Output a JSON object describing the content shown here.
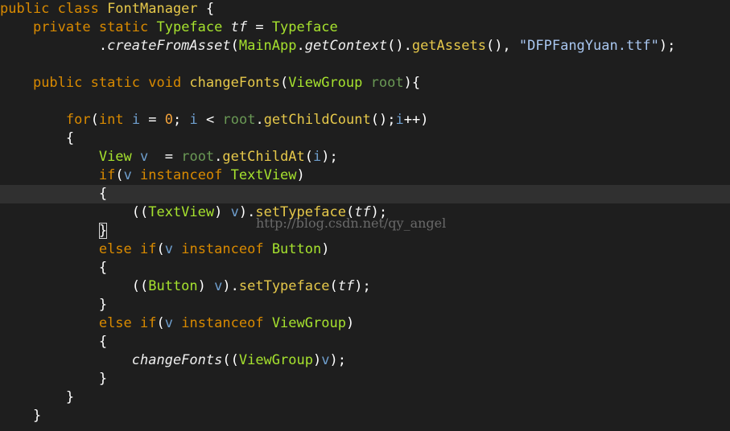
{
  "editor": {
    "lines": [
      [
        [
          "kw",
          "public class "
        ],
        [
          "fn",
          "FontManager"
        ],
        [
          "pu",
          " {"
        ]
      ],
      [
        [
          "pu",
          "    "
        ],
        [
          "kw",
          "private static "
        ],
        [
          "ty",
          "Typeface "
        ],
        [
          "it",
          "tf"
        ],
        [
          "op",
          " = "
        ],
        [
          "ty",
          "Typeface"
        ]
      ],
      [
        [
          "pu",
          "            ."
        ],
        [
          "it",
          "createFromAsset"
        ],
        [
          "pu",
          "("
        ],
        [
          "ty",
          "MainApp"
        ],
        [
          "pu",
          "."
        ],
        [
          "it",
          "getContext"
        ],
        [
          "pu",
          "()."
        ],
        [
          "fn",
          "getAssets"
        ],
        [
          "pu",
          "(), "
        ],
        [
          "str",
          "\"DFPFangYuan.ttf\""
        ],
        [
          "pu",
          ");"
        ]
      ],
      [],
      [
        [
          "pu",
          "    "
        ],
        [
          "kw",
          "public static void "
        ],
        [
          "fn",
          "changeFonts"
        ],
        [
          "pu",
          "("
        ],
        [
          "ty",
          "ViewGroup "
        ],
        [
          "fld",
          "root"
        ],
        [
          "pu",
          "){"
        ]
      ],
      [],
      [
        [
          "pu",
          "        "
        ],
        [
          "kw",
          "for"
        ],
        [
          "pu",
          "("
        ],
        [
          "kw",
          "int "
        ],
        [
          "var",
          "i"
        ],
        [
          "op",
          " = "
        ],
        [
          "num",
          "0"
        ],
        [
          "pu",
          "; "
        ],
        [
          "var",
          "i"
        ],
        [
          "op",
          " < "
        ],
        [
          "fld",
          "root"
        ],
        [
          "pu",
          "."
        ],
        [
          "fn",
          "getChildCount"
        ],
        [
          "pu",
          "();"
        ],
        [
          "var",
          "i"
        ],
        [
          "op",
          "++"
        ],
        [
          "pu",
          ")"
        ]
      ],
      [
        [
          "pu",
          "        {"
        ]
      ],
      [
        [
          "pu",
          "            "
        ],
        [
          "ty",
          "View "
        ],
        [
          "var",
          "v"
        ],
        [
          "op",
          "  = "
        ],
        [
          "fld",
          "root"
        ],
        [
          "pu",
          "."
        ],
        [
          "fn",
          "getChildAt"
        ],
        [
          "pu",
          "("
        ],
        [
          "var",
          "i"
        ],
        [
          "pu",
          ");"
        ]
      ],
      [
        [
          "pu",
          "            "
        ],
        [
          "kw",
          "if"
        ],
        [
          "pu",
          "("
        ],
        [
          "var",
          "v"
        ],
        [
          "kw",
          " instanceof "
        ],
        [
          "ty",
          "TextView"
        ],
        [
          "pu",
          ")"
        ]
      ],
      [
        [
          "pu",
          "            {"
        ]
      ],
      [
        [
          "pu",
          "                (("
        ],
        [
          "ty",
          "TextView"
        ],
        [
          "pu",
          ") "
        ],
        [
          "var",
          "v"
        ],
        [
          "pu",
          ")."
        ],
        [
          "fn",
          "setTypeface"
        ],
        [
          "pu",
          "("
        ],
        [
          "it",
          "tf"
        ],
        [
          "pu",
          ");"
        ]
      ],
      [
        [
          "pu",
          "            "
        ],
        [
          "caret",
          "}"
        ]
      ],
      [
        [
          "pu",
          "            "
        ],
        [
          "kw",
          "else if"
        ],
        [
          "pu",
          "("
        ],
        [
          "var",
          "v"
        ],
        [
          "kw",
          " instanceof "
        ],
        [
          "ty",
          "Button"
        ],
        [
          "pu",
          ")"
        ]
      ],
      [
        [
          "pu",
          "            {"
        ]
      ],
      [
        [
          "pu",
          "                (("
        ],
        [
          "ty",
          "Button"
        ],
        [
          "pu",
          ") "
        ],
        [
          "var",
          "v"
        ],
        [
          "pu",
          ")."
        ],
        [
          "fn",
          "setTypeface"
        ],
        [
          "pu",
          "("
        ],
        [
          "it",
          "tf"
        ],
        [
          "pu",
          ");"
        ]
      ],
      [
        [
          "pu",
          "            }"
        ]
      ],
      [
        [
          "pu",
          "            "
        ],
        [
          "kw",
          "else if"
        ],
        [
          "pu",
          "("
        ],
        [
          "var",
          "v"
        ],
        [
          "kw",
          " instanceof "
        ],
        [
          "ty",
          "ViewGroup"
        ],
        [
          "pu",
          ")"
        ]
      ],
      [
        [
          "pu",
          "            {"
        ]
      ],
      [
        [
          "pu",
          "                "
        ],
        [
          "it",
          "changeFonts"
        ],
        [
          "pu",
          "(("
        ],
        [
          "ty",
          "ViewGroup"
        ],
        [
          "pu",
          ")"
        ],
        [
          "var",
          "v"
        ],
        [
          "pu",
          ");"
        ]
      ],
      [
        [
          "pu",
          "            }"
        ]
      ],
      [
        [
          "pu",
          "        }"
        ]
      ],
      [
        [
          "pu",
          "    }"
        ]
      ]
    ],
    "current_line_index": 10
  },
  "watermark": "http://blog.csdn.net/qy_angel",
  "colors": {
    "background": "#1e1e1e",
    "keyword": "#d98a00",
    "type": "#a6e22e",
    "method": "#e6c84a",
    "variable": "#6f9fce",
    "string": "#a9c7f0",
    "field": "#6a9955",
    "number": "#f2a23b"
  }
}
